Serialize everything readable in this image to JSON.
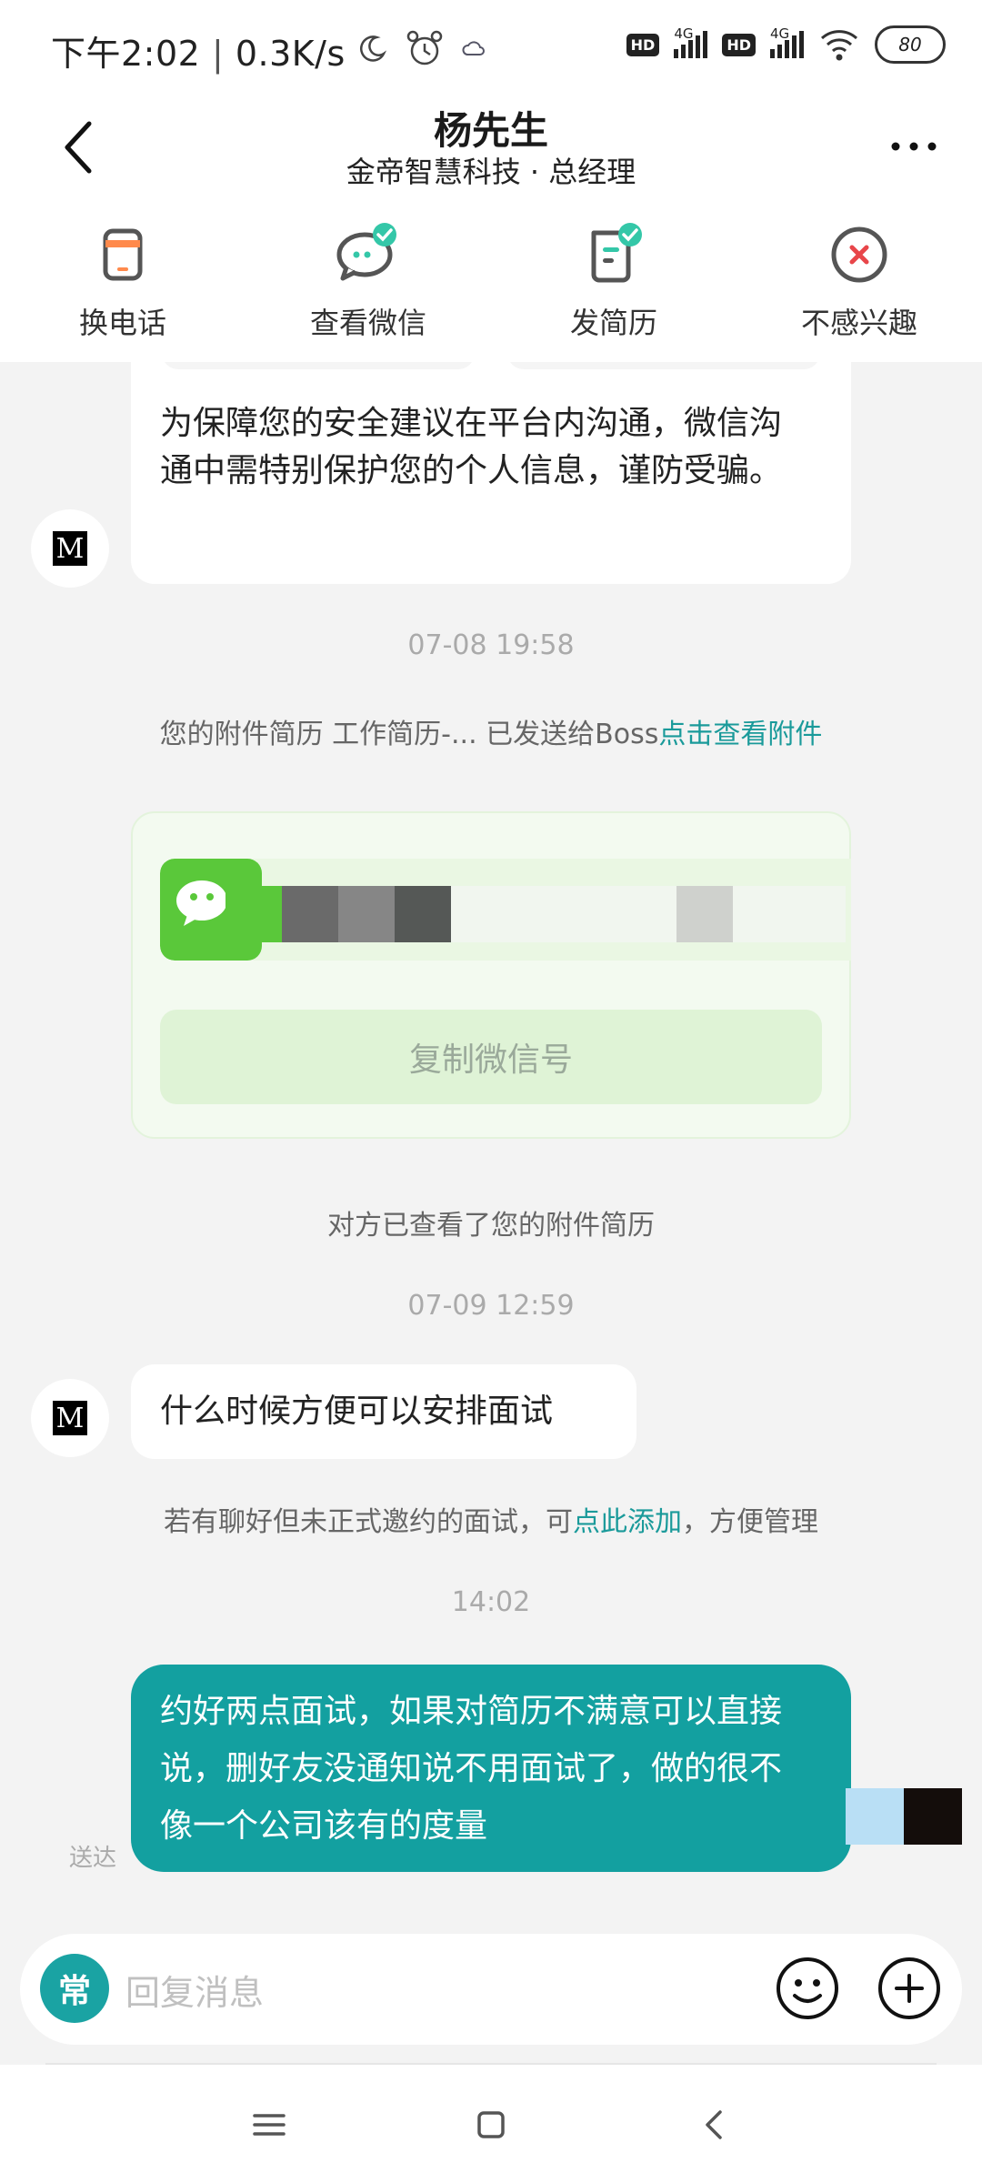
{
  "status_bar": {
    "time": "下午2:02",
    "speed": "0.3K/s",
    "hd1": "HD",
    "net1": "4G",
    "hd2": "HD",
    "net2": "4G",
    "battery": "80"
  },
  "header": {
    "title": "杨先生",
    "subtitle": "金帝智慧科技 · 总经理",
    "actions": [
      {
        "label": "换电话",
        "icon": "phone-swap-icon"
      },
      {
        "label": "查看微信",
        "icon": "wechat-check-icon"
      },
      {
        "label": "发简历",
        "icon": "resume-check-icon"
      },
      {
        "label": "不感兴趣",
        "icon": "not-interested-icon"
      }
    ]
  },
  "chat": {
    "warning_text": "为保障您的安全建议在平台内沟通，微信沟通中需特别保护您的个人信息，谨防受骗。",
    "time1": "07-08 19:58",
    "resume_notice": "您的附件简历 工作简历-... 已发送给Boss",
    "resume_notice_link": "点击查看附件",
    "copy_wechat_button": "复制微信号",
    "viewed_notice": "对方已查看了您的附件简历",
    "time2": "07-09 12:59",
    "incoming_message": "什么时候方便可以安排面试",
    "interview_notice_prefix": "若有聊好但未正式邀约的面试，可",
    "interview_notice_link": "点此添加",
    "interview_notice_suffix": "，方便管理",
    "time3": "14:02",
    "outgoing_message": "约好两点面试，如果对简历不满意可以直接说，删好友没通知说不用面试了，做的很不像一个公司该有的度量",
    "delivered_status": "送达"
  },
  "input_bar": {
    "common_phrases": "常",
    "placeholder": "回复消息"
  },
  "colors": {
    "accent": "#1aa3a3",
    "outgoing_bubble": "#13a0a0",
    "wechat_green": "#5ac83a",
    "link": "#1a9a9a",
    "danger": "#e8464a"
  }
}
